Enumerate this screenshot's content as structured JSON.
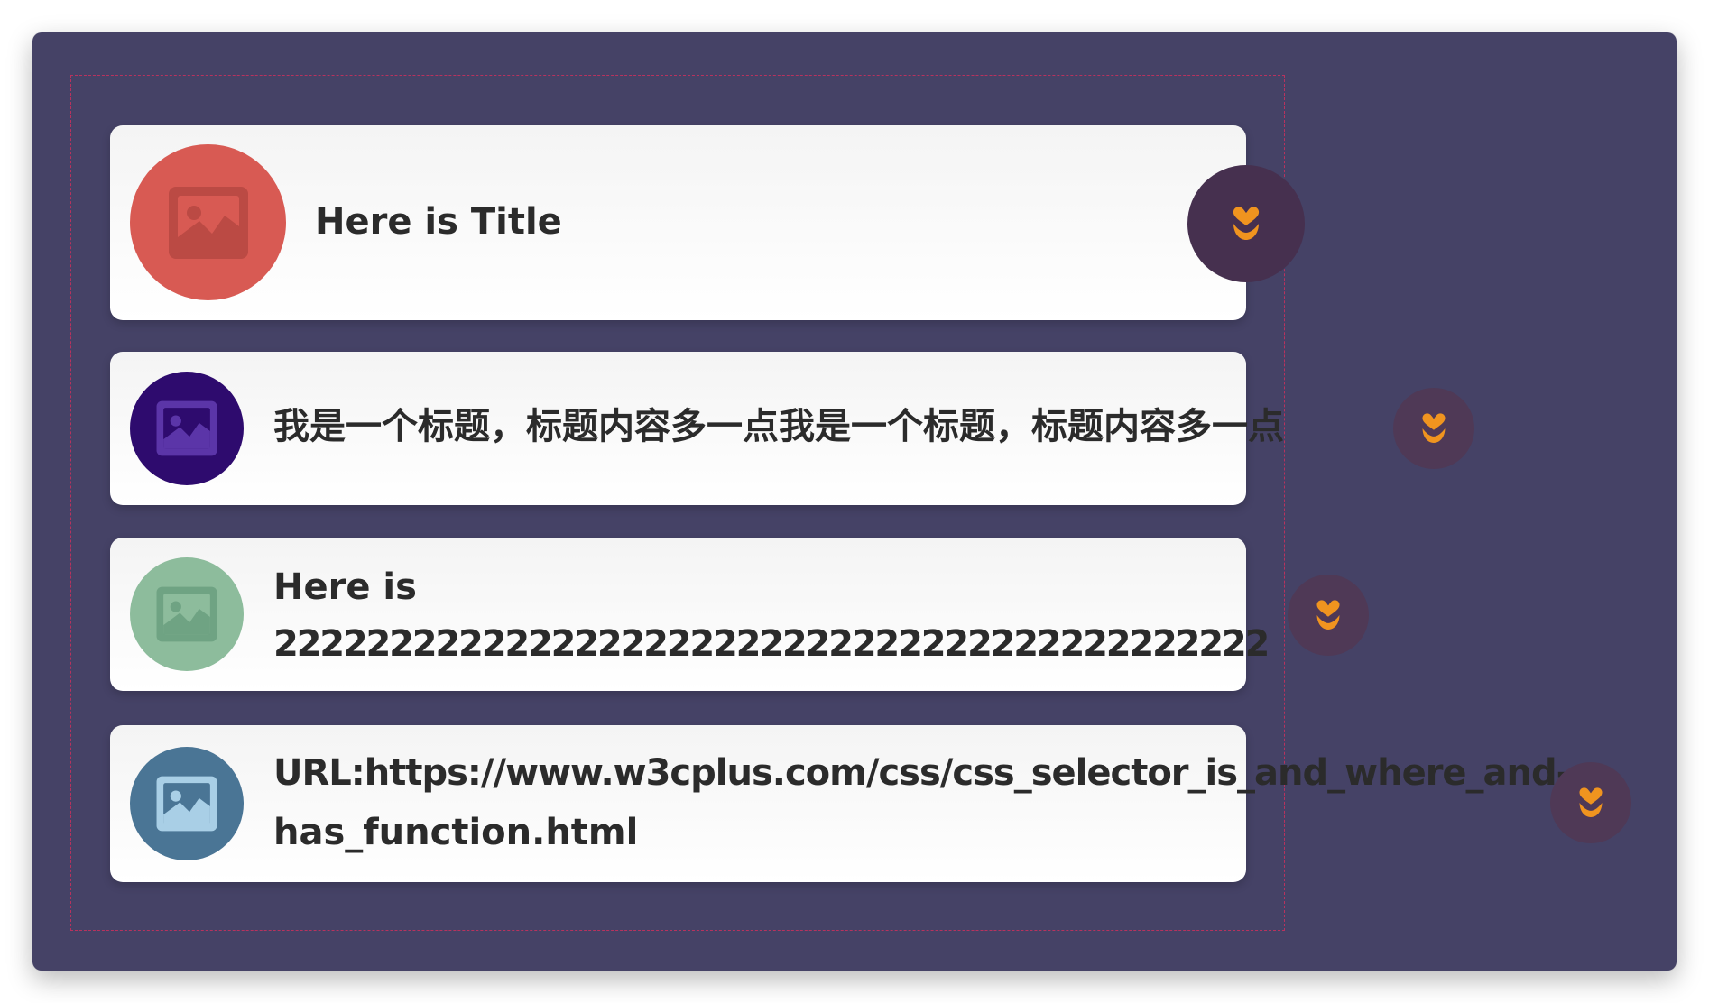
{
  "cards": [
    {
      "title": "Here is Title",
      "avatar_icon": "image-icon",
      "avatar_color": "#d85a53",
      "like_icon": "heart-flower-icon"
    },
    {
      "title": "我是一个标题，标题内容多一点我是一个标题，标题内容多一点",
      "avatar_icon": "image-icon",
      "avatar_color": "#2e0b6e",
      "like_icon": "heart-flower-icon"
    },
    {
      "title_line1": "Here is",
      "title_line2": "2222222222222222222222222222222222222222222",
      "avatar_icon": "image-icon",
      "avatar_color": "#8dbc9c",
      "like_icon": "heart-flower-icon"
    },
    {
      "title_line1": "URL:https://www.w3cplus.com/css/css_selector_is_and_where_and-",
      "title_line2": "has_function.html",
      "avatar_icon": "image-icon",
      "avatar_color": "#4a7595",
      "like_icon": "heart-flower-icon"
    }
  ],
  "colors": {
    "background": "#454266",
    "card": "#ffffff",
    "like_button": "#46304f",
    "like_icon": "#f0941f",
    "outline": "#b8325e"
  }
}
